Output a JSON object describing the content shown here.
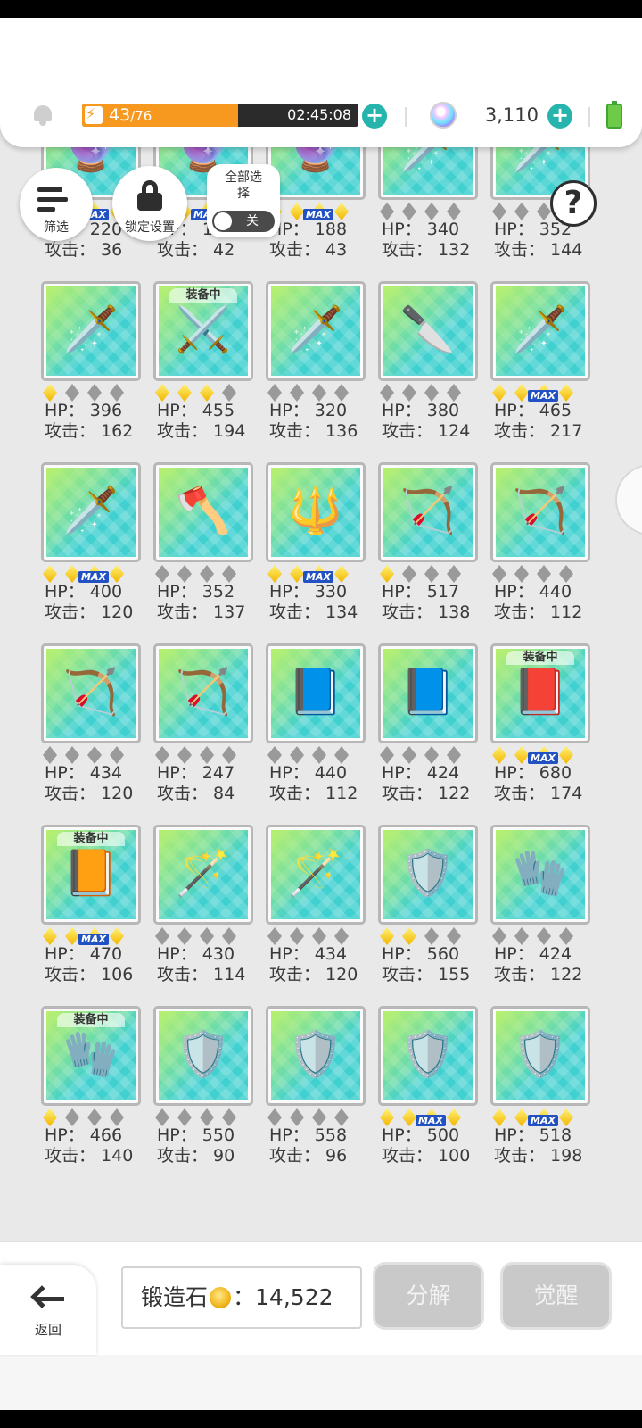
{
  "topbar": {
    "stamina_current": "43",
    "stamina_max": "/76",
    "stamina_fraction": 0.566,
    "timer": "02:45:08",
    "gem_count": "3,110",
    "colors": {
      "stamina": "#f7981f",
      "plus": "#27b4ad",
      "battery": "#6dcb48"
    }
  },
  "controls": {
    "filter_label": "筛选",
    "lock_label": "锁定设置",
    "select_all_label": "全部选择",
    "toggle_label": "关",
    "help_label": "?"
  },
  "items": [
    {
      "stars": 3,
      "max": true,
      "hp": "HP： 220",
      "atk": "攻击： 36",
      "equipped": false,
      "icon": "crystal-orb-icon",
      "glyph": "🔮"
    },
    {
      "stars": 3,
      "max": true,
      "hp": "HP： 192",
      "atk": "攻击： 42",
      "equipped": false,
      "icon": "crystal-orb-icon",
      "glyph": "🔮"
    },
    {
      "stars": 3,
      "max": true,
      "hp": "HP： 188",
      "atk": "攻击： 43",
      "equipped": false,
      "icon": "crystal-orb-icon",
      "glyph": "🔮"
    },
    {
      "stars": 0,
      "max": false,
      "hp": "HP： 340",
      "atk": "攻击： 132",
      "equipped": false,
      "icon": "sword-icon",
      "glyph": "🗡️"
    },
    {
      "stars": 0,
      "max": false,
      "hp": "HP： 352",
      "atk": "攻击： 144",
      "equipped": false,
      "icon": "sword-icon",
      "glyph": "🗡️"
    },
    {
      "stars": 1,
      "max": false,
      "hp": "HP： 396",
      "atk": "攻击： 162",
      "equipped": false,
      "icon": "sword-icon",
      "glyph": "🗡️"
    },
    {
      "stars": 3,
      "max": false,
      "hp": "HP： 455",
      "atk": "攻击： 194",
      "equipped": true,
      "icon": "crossed-swords-icon",
      "glyph": "⚔️"
    },
    {
      "stars": 0,
      "max": false,
      "hp": "HP： 320",
      "atk": "攻击： 136",
      "equipped": false,
      "icon": "chainsaw-sword-icon",
      "glyph": "🗡️"
    },
    {
      "stars": 0,
      "max": false,
      "hp": "HP： 380",
      "atk": "攻击： 124",
      "equipped": false,
      "icon": "dagger-icon",
      "glyph": "🔪"
    },
    {
      "stars": 3,
      "max": true,
      "hp": "HP： 465",
      "atk": "攻击： 217",
      "equipped": false,
      "icon": "sword-icon",
      "glyph": "🗡️"
    },
    {
      "stars": 3,
      "max": true,
      "hp": "HP： 400",
      "atk": "攻击： 120",
      "equipped": false,
      "icon": "sword-icon",
      "glyph": "🗡️"
    },
    {
      "stars": 0,
      "max": false,
      "hp": "HP： 352",
      "atk": "攻击： 137",
      "equipped": false,
      "icon": "axe-icon",
      "glyph": "🪓"
    },
    {
      "stars": 3,
      "max": true,
      "hp": "HP： 330",
      "atk": "攻击： 134",
      "equipped": false,
      "icon": "spear-icon",
      "glyph": "🔱"
    },
    {
      "stars": 1,
      "max": false,
      "hp": "HP： 517",
      "atk": "攻击： 138",
      "equipped": false,
      "icon": "bow-icon",
      "glyph": "🏹"
    },
    {
      "stars": 0,
      "max": false,
      "hp": "HP： 440",
      "atk": "攻击： 112",
      "equipped": false,
      "icon": "bow-icon",
      "glyph": "🏹"
    },
    {
      "stars": 0,
      "max": false,
      "hp": "HP： 434",
      "atk": "攻击： 120",
      "equipped": false,
      "icon": "bow-icon",
      "glyph": "🏹"
    },
    {
      "stars": 0,
      "max": false,
      "hp": "HP： 247",
      "atk": "攻击： 84",
      "equipped": false,
      "icon": "bow-icon",
      "glyph": "🏹"
    },
    {
      "stars": 0,
      "max": false,
      "hp": "HP： 440",
      "atk": "攻击： 112",
      "equipped": false,
      "icon": "tome-icon",
      "glyph": "📘"
    },
    {
      "stars": 0,
      "max": false,
      "hp": "HP： 424",
      "atk": "攻击： 122",
      "equipped": false,
      "icon": "tome-icon",
      "glyph": "📘"
    },
    {
      "stars": 3,
      "max": true,
      "hp": "HP： 680",
      "atk": "攻击： 174",
      "equipped": true,
      "icon": "tome-icon",
      "glyph": "📕"
    },
    {
      "stars": 3,
      "max": true,
      "hp": "HP： 470",
      "atk": "攻击： 106",
      "equipped": true,
      "icon": "tome-icon",
      "glyph": "📙"
    },
    {
      "stars": 0,
      "max": false,
      "hp": "HP： 430",
      "atk": "攻击： 114",
      "equipped": false,
      "icon": "staff-icon",
      "glyph": "🪄"
    },
    {
      "stars": 0,
      "max": false,
      "hp": "HP： 434",
      "atk": "攻击： 120",
      "equipped": false,
      "icon": "staff-icon",
      "glyph": "🪄"
    },
    {
      "stars": 2,
      "max": false,
      "hp": "HP： 560",
      "atk": "攻击： 155",
      "equipped": false,
      "icon": "gauntlet-icon",
      "glyph": "🛡️"
    },
    {
      "stars": 0,
      "max": false,
      "hp": "HP： 424",
      "atk": "攻击： 122",
      "equipped": false,
      "icon": "gauntlet-icon",
      "glyph": "🧤"
    },
    {
      "stars": 1,
      "max": false,
      "hp": "HP： 466",
      "atk": "攻击： 140",
      "equipped": true,
      "icon": "gauntlet-icon",
      "glyph": "🧤"
    },
    {
      "stars": 0,
      "max": false,
      "hp": "HP： 550",
      "atk": "攻击： 90",
      "equipped": false,
      "icon": "shield-icon",
      "glyph": "🛡️"
    },
    {
      "stars": 0,
      "max": false,
      "hp": "HP： 558",
      "atk": "攻击： 96",
      "equipped": false,
      "icon": "shield-icon",
      "glyph": "🛡️"
    },
    {
      "stars": 3,
      "max": true,
      "hp": "HP： 500",
      "atk": "攻击： 100",
      "equipped": false,
      "icon": "shield-icon",
      "glyph": "🛡️"
    },
    {
      "stars": 3,
      "max": true,
      "hp": "HP： 518",
      "atk": "攻击： 198",
      "equipped": false,
      "icon": "shield-icon",
      "glyph": "🛡️"
    }
  ],
  "labels": {
    "equipped": "装备中",
    "max": "MAX"
  },
  "bottom": {
    "back_label": "返回",
    "forge_label": "锻造石",
    "forge_value": "14,522",
    "forge_separator": "：",
    "decompose_label": "分解",
    "awaken_label": "觉醒"
  }
}
